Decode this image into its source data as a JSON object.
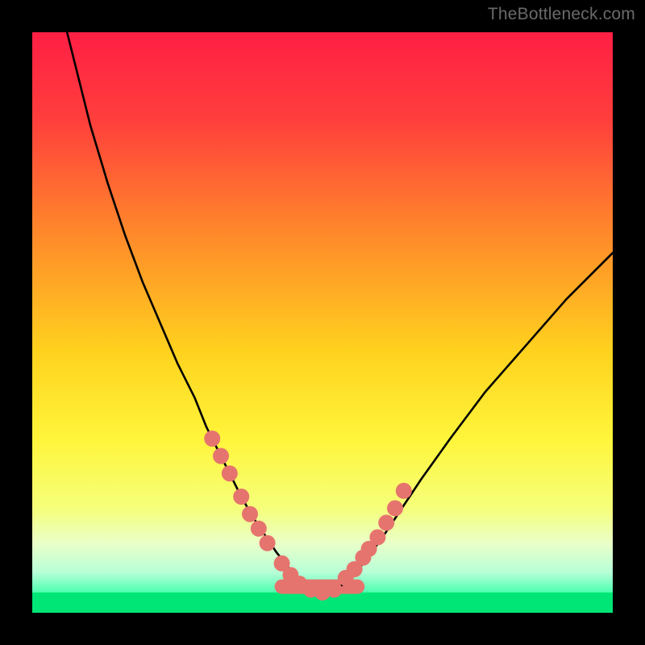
{
  "watermark": "TheBottleneck.com",
  "chart_data": {
    "type": "line",
    "title": "",
    "xlabel": "",
    "ylabel": "",
    "xlim": [
      0,
      100
    ],
    "ylim": [
      0,
      100
    ],
    "gradient_stops": [
      {
        "offset": 0.0,
        "color": "#ff1f44"
      },
      {
        "offset": 0.15,
        "color": "#ff3e3c"
      },
      {
        "offset": 0.35,
        "color": "#ff8a2a"
      },
      {
        "offset": 0.55,
        "color": "#ffd21e"
      },
      {
        "offset": 0.7,
        "color": "#fff53a"
      },
      {
        "offset": 0.82,
        "color": "#f5ff7a"
      },
      {
        "offset": 0.88,
        "color": "#eaffc8"
      },
      {
        "offset": 0.93,
        "color": "#b8ffd8"
      },
      {
        "offset": 0.965,
        "color": "#4dffb0"
      },
      {
        "offset": 1.0,
        "color": "#00e676"
      }
    ],
    "bottom_band": {
      "color": "#00e676",
      "y": 96.5,
      "height": 3.5
    },
    "series": [
      {
        "name": "bottleneck-curve",
        "type": "line",
        "x": [
          6,
          8,
          10,
          13,
          16,
          19,
          22,
          25,
          28,
          30,
          32,
          34,
          36,
          38,
          40,
          42,
          44,
          45.5,
          47,
          49,
          51,
          53,
          55,
          57,
          60,
          63,
          67,
          72,
          78,
          85,
          92,
          100
        ],
        "y": [
          0,
          8,
          16,
          26,
          35,
          43,
          50,
          57,
          63,
          68,
          72,
          76,
          80,
          83.5,
          86.5,
          89.5,
          92,
          94,
          95.5,
          96.5,
          96.5,
          95.5,
          94,
          91.5,
          87.5,
          83,
          77,
          70,
          62,
          54,
          46,
          38
        ],
        "color": "#000000",
        "stroke_width": 2.6
      },
      {
        "name": "salmon-dots",
        "type": "scatter",
        "x": [
          31,
          32.5,
          34,
          36,
          37.5,
          39,
          40.5,
          43,
          44.5,
          46,
          48,
          50,
          52,
          54,
          55.5,
          57,
          58,
          59.5,
          61,
          62.5,
          64
        ],
        "y": [
          70,
          73,
          76,
          80,
          83,
          85.5,
          88,
          91.5,
          93.5,
          95,
          96,
          96.5,
          96,
          94,
          92.5,
          90.5,
          89,
          87,
          84.5,
          82,
          79
        ],
        "color": "#e6746e",
        "marker_radius": 10
      }
    ],
    "segments": [
      {
        "name": "salmon-trough-band",
        "type": "line",
        "x": [
          43,
          56
        ],
        "y": [
          95.5,
          95.5
        ],
        "color": "#e6746e",
        "stroke_width": 18,
        "linecap": "round"
      }
    ]
  }
}
